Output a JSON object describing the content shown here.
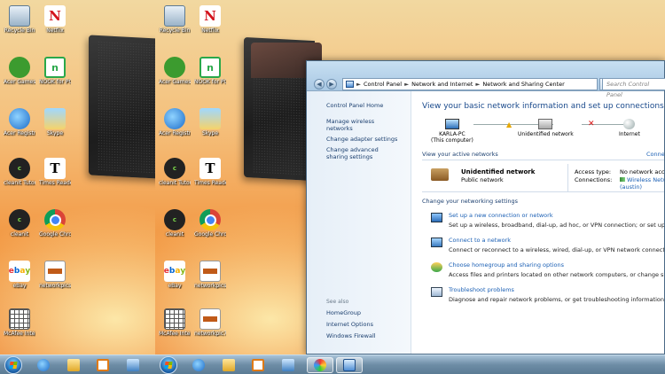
{
  "desktop": {
    "icons": [
      {
        "name": "recycle-bin-icon",
        "label": "Recycle Bin"
      },
      {
        "name": "netflix-icon",
        "label": "Netflix"
      },
      {
        "name": "acer-games-icon",
        "label": "Acer Games"
      },
      {
        "name": "nook-icon",
        "label": "NOOK for PC"
      },
      {
        "name": "acer-registration-icon",
        "label": "Acer Registration"
      },
      {
        "name": "skype-icon",
        "label": "Skype"
      },
      {
        "name": "cleanit-tutorial-icon",
        "label": "cleanit Tutorial"
      },
      {
        "name": "times-reader-icon",
        "label": "Times Reader"
      },
      {
        "name": "cleanit-icon",
        "label": "cleanit"
      },
      {
        "name": "google-chrome-icon",
        "label": "Google Chrome"
      },
      {
        "name": "ebay-icon",
        "label": "eBay"
      },
      {
        "name": "networkpics-icon",
        "label": "networkpics1"
      },
      {
        "name": "mcafee-icon",
        "label": "McAfee Internet Sc..."
      }
    ],
    "right_networkpic_label": "networkpic7"
  },
  "taskbar": {
    "icons": [
      "start-orb-icon",
      "internet-explorer-icon",
      "explorer-folder-icon",
      "media-player-icon",
      "network-icon",
      "paint-icon",
      "control-panel-icon"
    ]
  },
  "window": {
    "address": {
      "seg1": "Control Panel",
      "seg2": "Network and Internet",
      "seg3": "Network and Sharing Center",
      "sep": "►"
    },
    "search_placeholder": "Search Control Panel",
    "left_pane": {
      "home": "Control Panel Home",
      "links": [
        "Manage wireless networks",
        "Change adapter settings",
        "Change advanced sharing settings"
      ],
      "see_also_header": "See also",
      "see_also": [
        "HomeGroup",
        "Internet Options",
        "Windows Firewall"
      ]
    },
    "content": {
      "heading": "View your basic network information and set up connections",
      "map": {
        "computer": "KARLA-PC",
        "computer_sub": "(This computer)",
        "network": "Unidentified network",
        "internet": "Internet"
      },
      "active_header": "View your active networks",
      "active_header_right": "Connect",
      "active": {
        "name": "Unidentified network",
        "type": "Public network",
        "access_label": "Access type:",
        "access_value": "No network access",
        "connections_label": "Connections:",
        "connection_line1": "Wireless Network",
        "connection_line2": "(austin)"
      },
      "settings_header": "Change your networking settings",
      "tasks": [
        {
          "title": "Set up a new connection or network",
          "desc": "Set up a wireless, broadband, dial-up, ad hoc, or VPN connection; or set up a router o"
        },
        {
          "title": "Connect to a network",
          "desc": "Connect or reconnect to a wireless, wired, dial-up, or VPN network connection."
        },
        {
          "title": "Choose homegroup and sharing options",
          "desc": "Access files and printers located on other network computers, or change sharing setti"
        },
        {
          "title": "Troubleshoot problems",
          "desc": "Diagnose and repair network problems, or get troubleshooting information."
        }
      ]
    }
  }
}
